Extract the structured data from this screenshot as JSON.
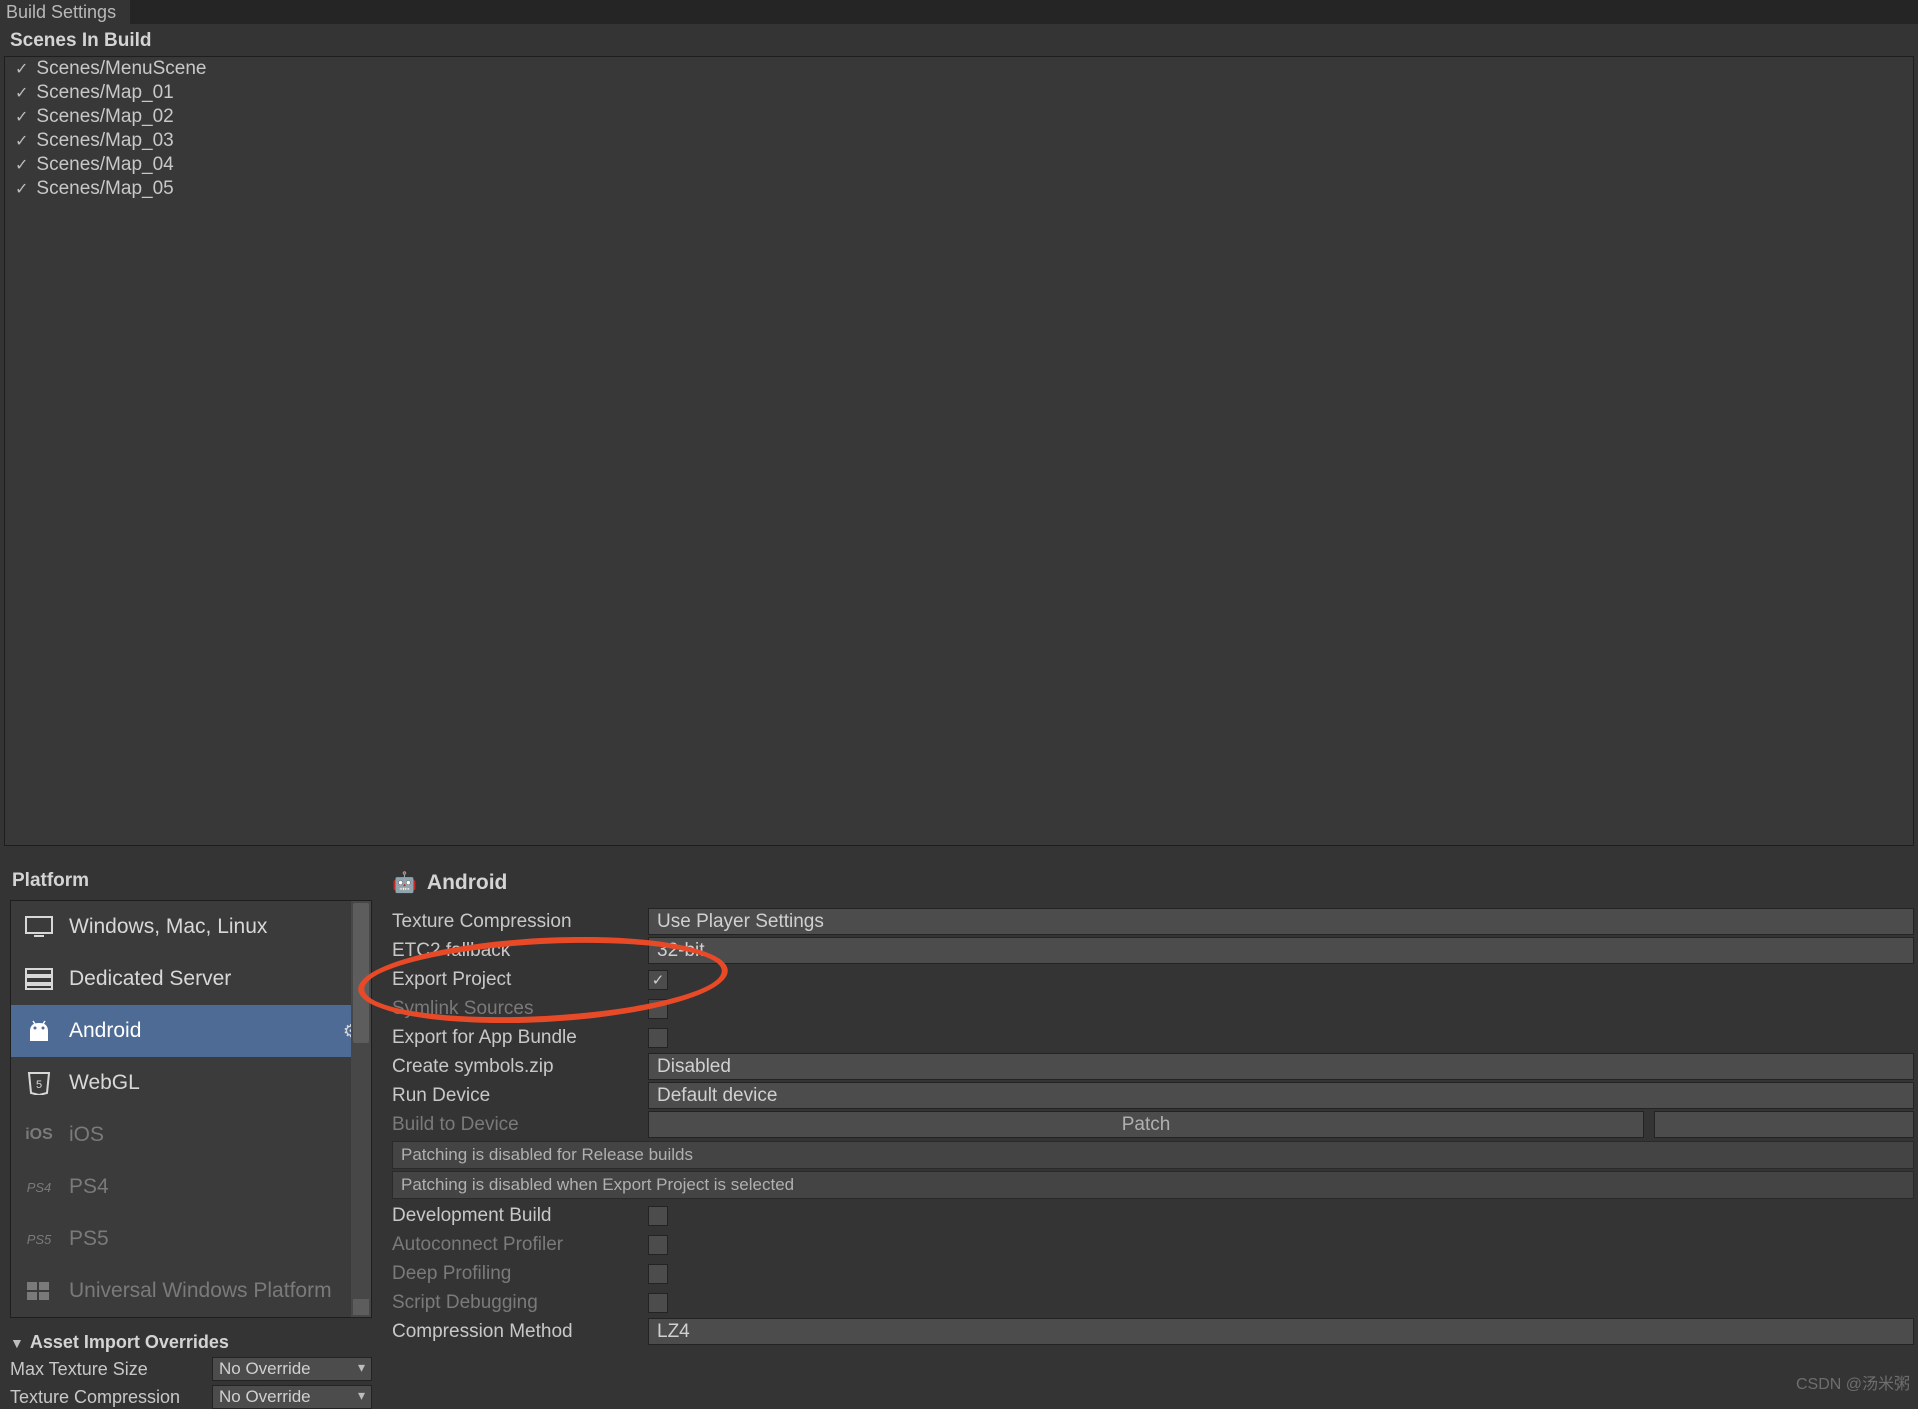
{
  "window_tab": "Build Settings",
  "scenes_header": "Scenes In Build",
  "scenes": [
    "Scenes/MenuScene",
    "Scenes/Map_01",
    "Scenes/Map_02",
    "Scenes/Map_03",
    "Scenes/Map_04",
    "Scenes/Map_05"
  ],
  "platform_header": "Platform",
  "platforms": [
    {
      "label": "Windows, Mac, Linux"
    },
    {
      "label": "Dedicated Server"
    },
    {
      "label": "Android"
    },
    {
      "label": "WebGL"
    },
    {
      "label": "iOS"
    },
    {
      "label": "PS4"
    },
    {
      "label": "PS5"
    },
    {
      "label": "Universal Windows Platform"
    }
  ],
  "overrides": {
    "header": "Asset Import Overrides",
    "max_texture_label": "Max Texture Size",
    "max_texture_value": "No Override",
    "tex_comp_label": "Texture Compression",
    "tex_comp_value": "No Override"
  },
  "settings": {
    "title": "Android",
    "rows": {
      "tex_comp": {
        "label": "Texture Compression",
        "value": "Use Player Settings"
      },
      "etc2": {
        "label": "ETC2 fallback",
        "value": "32-bit"
      },
      "export_project": {
        "label": "Export Project",
        "checked": true
      },
      "symlink": {
        "label": "Symlink Sources",
        "checked": false
      },
      "app_bundle": {
        "label": "Export for App Bundle",
        "checked": false
      },
      "create_symbols": {
        "label": "Create symbols.zip",
        "value": "Disabled"
      },
      "run_device": {
        "label": "Run Device",
        "value": "Default device"
      },
      "build_to_device": {
        "label": "Build to Device",
        "button": "Patch"
      },
      "note1": "Patching is disabled for Release builds",
      "note2": "Patching is disabled when Export Project is selected",
      "dev_build": {
        "label": "Development Build",
        "checked": false
      },
      "autoconnect": {
        "label": "Autoconnect Profiler",
        "checked": false
      },
      "deep_prof": {
        "label": "Deep Profiling",
        "checked": false
      },
      "script_debug": {
        "label": "Script Debugging",
        "checked": false
      },
      "comp_method": {
        "label": "Compression Method",
        "value": "LZ4"
      }
    }
  },
  "watermark": "CSDN @汤米粥"
}
